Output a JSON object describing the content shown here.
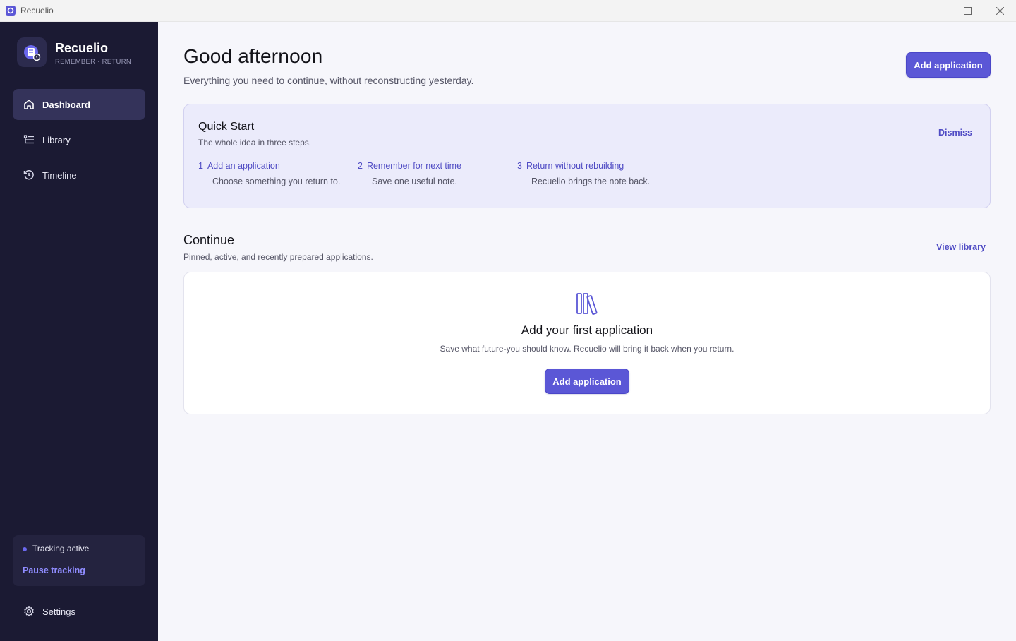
{
  "window": {
    "title": "Recuelio"
  },
  "brand": {
    "name": "Recuelio",
    "tagline": "REMEMBER · RETURN"
  },
  "sidebar": {
    "items": [
      {
        "label": "Dashboard",
        "icon": "home-icon",
        "active": true
      },
      {
        "label": "Library",
        "icon": "list-icon",
        "active": false
      },
      {
        "label": "Timeline",
        "icon": "history-icon",
        "active": false
      }
    ],
    "tracking": {
      "status": "Tracking active",
      "action": "Pause tracking"
    },
    "settings": {
      "label": "Settings",
      "icon": "gear-icon"
    }
  },
  "header": {
    "greeting": "Good afternoon",
    "subtitle": "Everything you need to continue, without reconstructing yesterday.",
    "add_button": "Add application"
  },
  "quick_start": {
    "title": "Quick Start",
    "subtitle": "The whole idea in three steps.",
    "dismiss": "Dismiss",
    "steps": [
      {
        "num": "1",
        "title": "Add an application",
        "desc": "Choose something you return to."
      },
      {
        "num": "2",
        "title": "Remember for next time",
        "desc": "Save one useful note."
      },
      {
        "num": "3",
        "title": "Return without rebuilding",
        "desc": "Recuelio brings the note back."
      }
    ]
  },
  "continue": {
    "title": "Continue",
    "subtitle": "Pinned, active, and recently prepared applications.",
    "view_library": "View library",
    "empty": {
      "icon": "books-icon",
      "title": "Add your first application",
      "subtitle": "Save what future-you should know. Recuelio will bring it back when you return.",
      "button": "Add application"
    }
  },
  "colors": {
    "accent": "#5b57d6",
    "sidebar_bg": "#1b1a33",
    "link": "#4f4bc4"
  }
}
